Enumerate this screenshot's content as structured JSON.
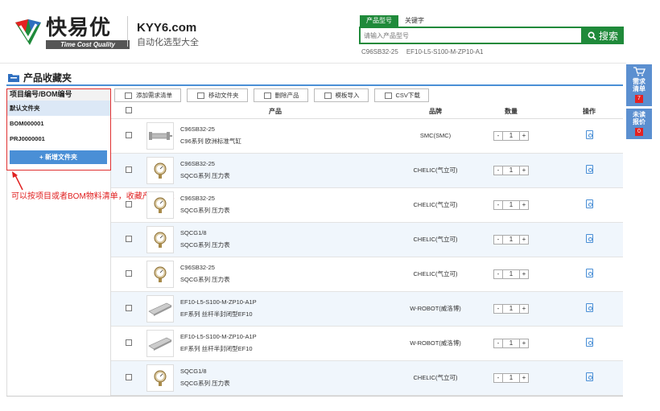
{
  "header": {
    "logo_cn": "快易优",
    "logo_en": "Time Cost Quality",
    "domain": "KYY6.com",
    "subtitle": "自动化选型大全",
    "search_tabs": [
      "产品型号",
      "关键字"
    ],
    "search_placeholder": "请输入产品型号",
    "search_button": "搜索",
    "search_hints": [
      "C96SB32-25",
      "EF10-L5-S100-M-ZP10-A1"
    ]
  },
  "float_panel": {
    "demand": {
      "label_1": "需求",
      "label_2": "清单",
      "count": "7"
    },
    "quote": {
      "label_1": "未读",
      "label_2": "报价",
      "count": "0"
    }
  },
  "page_title": "产品收藏夹",
  "folders": {
    "header": "项目编号/BOM编号",
    "items": [
      "默认文件夹",
      "BOM000001",
      "PRJ0000001"
    ],
    "new_button": "新增文件夹"
  },
  "annotation": "可以按项目或者BOM物料清单，收藏产品列表",
  "toolbar": [
    "添加需求清单",
    "移动文件夹",
    "删除产品",
    "模板导入",
    "CSV下载"
  ],
  "table": {
    "headers": {
      "product": "产品",
      "brand": "品牌",
      "qty": "数量",
      "op": "操作"
    },
    "rows": [
      {
        "code": "C96SB32-25",
        "desc": "C96系列 欧洲标准气缸",
        "brand": "SMC(SMC)",
        "qty": "1",
        "img": "cylinder"
      },
      {
        "code": "C96SB32-25",
        "desc": "SQCG系列 压力表",
        "brand": "CHELIC(气立可)",
        "qty": "1",
        "img": "gauge"
      },
      {
        "code": "C96SB32-25",
        "desc": "SQCG系列 压力表",
        "brand": "CHELIC(气立可)",
        "qty": "1",
        "img": "gauge"
      },
      {
        "code": "SQCG1/8",
        "desc": "SQCG系列 压力表",
        "brand": "CHELIC(气立可)",
        "qty": "1",
        "img": "gauge"
      },
      {
        "code": "C96SB32-25",
        "desc": "SQCG系列 压力表",
        "brand": "CHELIC(气立可)",
        "qty": "1",
        "img": "gauge"
      },
      {
        "code": "EF10-L5-S100-M-ZP10-A1P",
        "desc": "EF系列 丝杆半封闭型EF10",
        "brand": "W-ROBOT(威洛博)",
        "qty": "1",
        "img": "rail"
      },
      {
        "code": "EF10-L5-S100-M-ZP10-A1P",
        "desc": "EF系列 丝杆半封闭型EF10",
        "brand": "W-ROBOT(威洛博)",
        "qty": "1",
        "img": "rail"
      },
      {
        "code": "SQCG1/8",
        "desc": "SQCG系列 压力表",
        "brand": "CHELIC(气立可)",
        "qty": "1",
        "img": "gauge"
      }
    ]
  },
  "colors": {
    "green": "#1f8a3a",
    "blue": "#4a8fd6",
    "red": "#e02020"
  }
}
